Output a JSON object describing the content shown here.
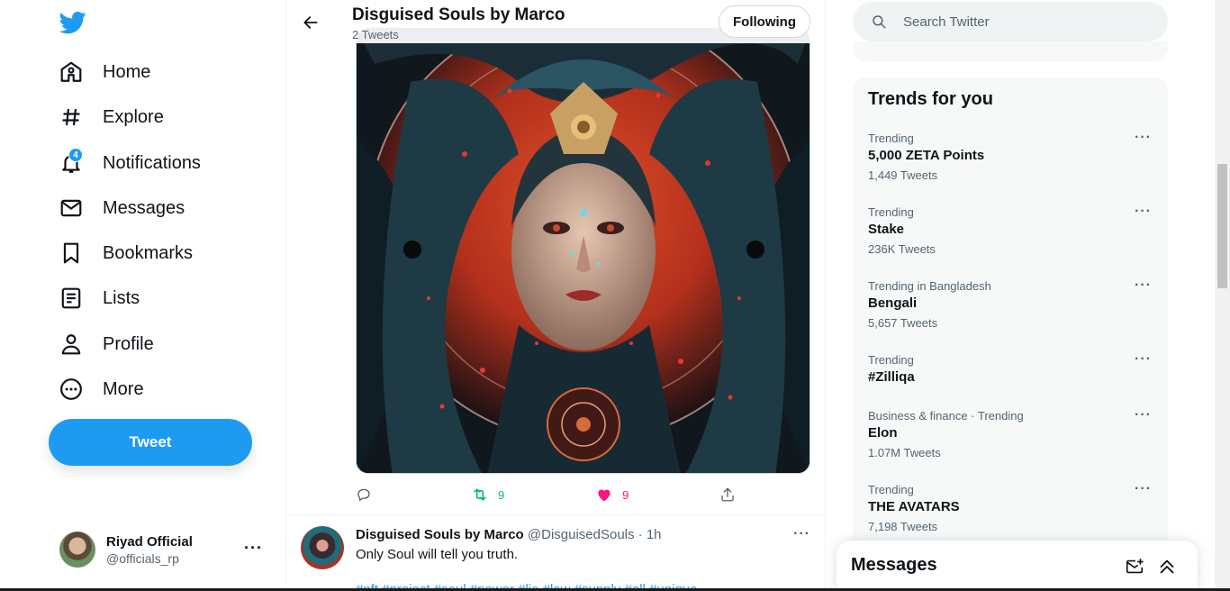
{
  "colors": {
    "accent": "#1d9bf0",
    "like": "#f91880",
    "retweet": "#00ba7c",
    "muted": "#536471"
  },
  "sidebar": {
    "logo_icon": "twitter-bird-icon",
    "nav": [
      {
        "label": "Home",
        "icon": "home-icon"
      },
      {
        "label": "Explore",
        "icon": "hashtag-icon"
      },
      {
        "label": "Notifications",
        "icon": "bell-icon",
        "badge": "4"
      },
      {
        "label": "Messages",
        "icon": "envelope-icon"
      },
      {
        "label": "Bookmarks",
        "icon": "bookmark-icon"
      },
      {
        "label": "Lists",
        "icon": "list-icon"
      },
      {
        "label": "Profile",
        "icon": "person-icon"
      },
      {
        "label": "More",
        "icon": "more-circle-icon"
      }
    ],
    "tweet_button": "Tweet",
    "account": {
      "name": "Riyad Official",
      "handle": "@officials_rp",
      "more": "···"
    }
  },
  "header": {
    "title": "Disguised Souls by Marco",
    "subtitle": "2 Tweets",
    "following_label": "Following"
  },
  "tweet_actions": {
    "retweets": "9",
    "likes": "9"
  },
  "tweet2": {
    "name": "Disguised Souls by Marco",
    "handle": "@DisguisedSouls · 1h",
    "text": "Only Soul will tell you truth.",
    "hashtags": "#nft #project #soul #power #lie #law #supply #all #unique",
    "more": "···"
  },
  "search": {
    "placeholder": "Search Twitter"
  },
  "trends": {
    "title": "Trends for you",
    "items": [
      {
        "context": "Trending",
        "name": "5,000 ZETA Points",
        "count": "1,449 Tweets"
      },
      {
        "context": "Trending",
        "name": "Stake",
        "count": "236K Tweets"
      },
      {
        "context": "Trending in Bangladesh",
        "name": "Bengali",
        "count": "5,657 Tweets"
      },
      {
        "context": "Trending",
        "name": "#Zilliqa",
        "count": ""
      },
      {
        "context": "Business & finance · Trending",
        "name": "Elon",
        "count": "1.07M Tweets"
      },
      {
        "context": "Trending",
        "name": "THE AVATARS",
        "count": "7,198 Tweets"
      }
    ],
    "more": "···"
  },
  "messages_drawer": {
    "title": "Messages"
  }
}
